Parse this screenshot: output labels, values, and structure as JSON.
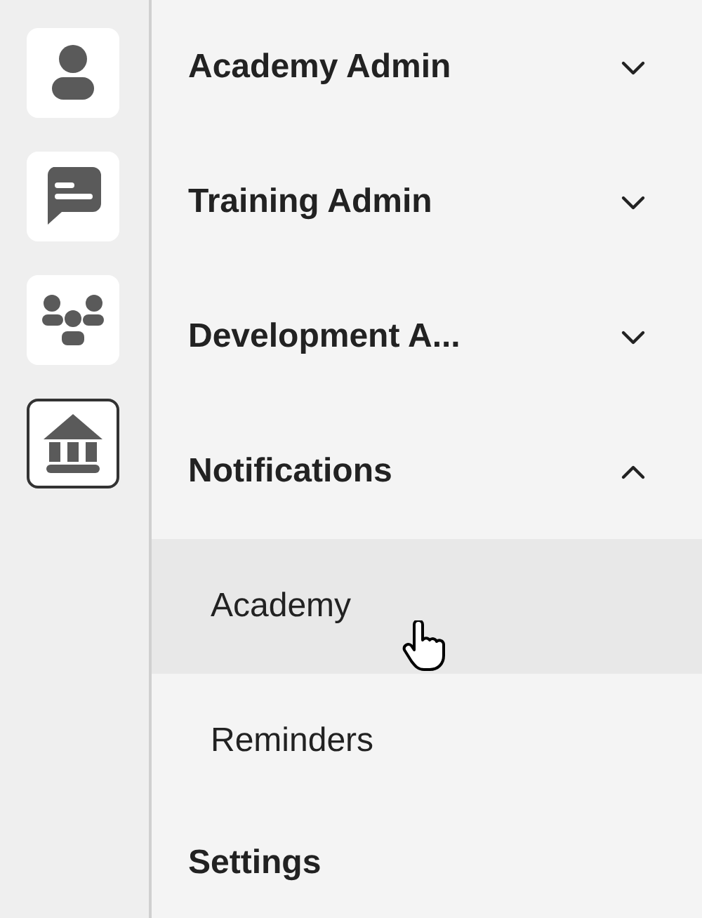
{
  "rail": [
    {
      "kind": "person",
      "selected": false
    },
    {
      "kind": "chat",
      "selected": false
    },
    {
      "kind": "group",
      "selected": false
    },
    {
      "kind": "bank",
      "selected": true
    }
  ],
  "menu": [
    {
      "kind": "group",
      "label": "Academy Admin",
      "expanded": false
    },
    {
      "kind": "group",
      "label": "Training Admin",
      "expanded": false
    },
    {
      "kind": "group",
      "label": "Development A...",
      "expanded": false
    },
    {
      "kind": "group",
      "label": "Notifications",
      "expanded": true,
      "children": [
        {
          "label": "Academy",
          "hovered": true
        },
        {
          "label": "Reminders",
          "hovered": false
        }
      ]
    },
    {
      "kind": "link",
      "label": "Settings"
    }
  ]
}
